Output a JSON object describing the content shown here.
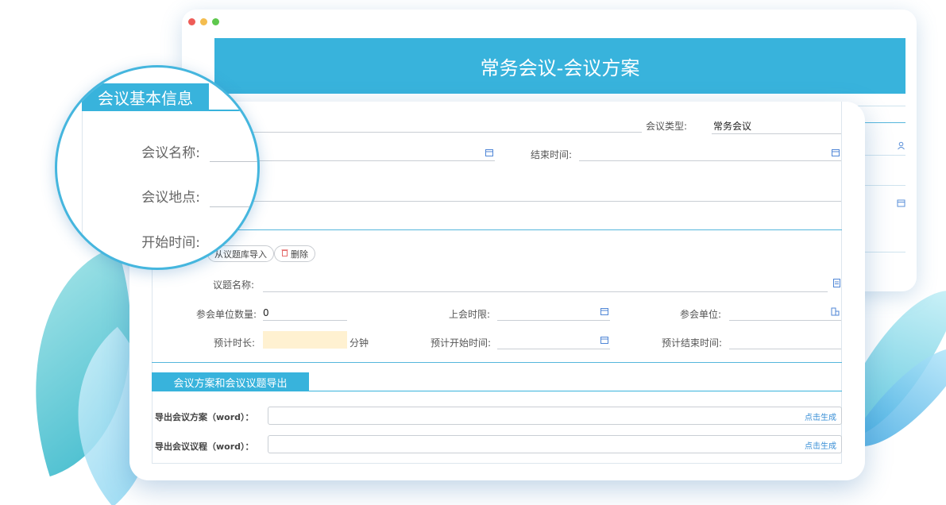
{
  "page": {
    "title": "常务会议-会议方案"
  },
  "basic_info": {
    "section_title": "会议基本信息",
    "meeting_name_label": "会议名称:",
    "meeting_place_label": "会议地点:",
    "start_time_label": "开始时间:",
    "meeting_type_label": "会议类型:",
    "meeting_type_value": "常务会议",
    "end_time_label": "结束时间:"
  },
  "topic": {
    "import_button": "从议题库导入",
    "delete_button": "删除",
    "topic_name_label": "议题名称:",
    "unit_count_label": "参会单位数量:",
    "unit_count_value": "0",
    "time_limit_label": "上会时限:",
    "attending_unit_label": "参会单位:",
    "duration_label": "预计时长:",
    "duration_unit": "分钟",
    "expected_start_label": "预计开始时间:",
    "expected_end_label": "预计结束时间:"
  },
  "export": {
    "section_title": "会议方案和会议议题导出",
    "plan_label": "导出会议方案（word）：",
    "agenda_label": "导出会议议程（word）：",
    "generate_label": "点击生成"
  },
  "icons": {
    "calendar": "calendar-icon",
    "user": "user-icon",
    "document": "document-icon",
    "org": "org-icon",
    "trash": "trash-icon"
  },
  "colors": {
    "accent": "#38b3dc",
    "highlight_input": "#fff1d1",
    "link": "#3a8fd6"
  }
}
